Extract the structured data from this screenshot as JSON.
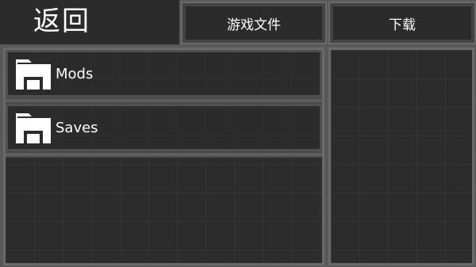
{
  "header": {
    "back_label": "返回",
    "tabs": [
      {
        "label": "游戏文件"
      },
      {
        "label": "下载"
      }
    ]
  },
  "files": {
    "items": [
      {
        "label": "Mods",
        "icon": "folder-icon"
      },
      {
        "label": "Saves",
        "icon": "folder-icon"
      }
    ]
  },
  "colors": {
    "panel_bg": "#2c2c2c",
    "frame": "#6a6a6a",
    "text": "#ffffff"
  }
}
